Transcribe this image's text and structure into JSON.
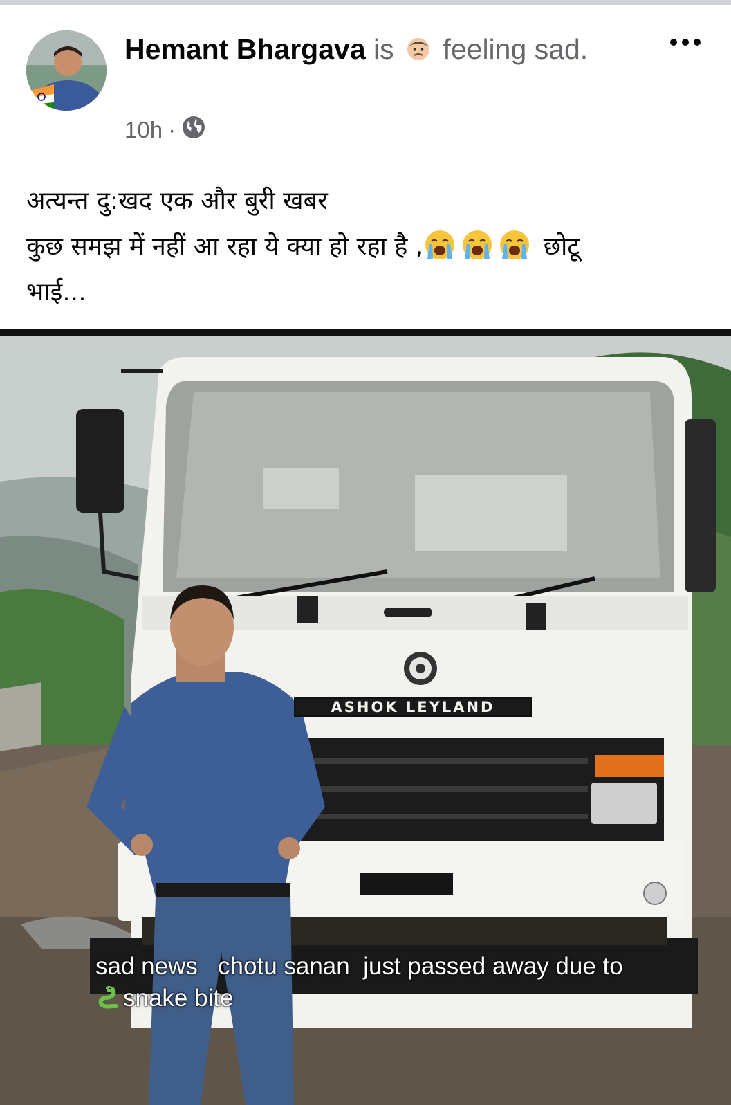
{
  "post": {
    "author": "Hemant Bhargava",
    "is_word": "is",
    "feeling_word": "feeling",
    "feeling": "sad.",
    "time": "10h",
    "separator": "·",
    "privacy_icon": "globe-icon",
    "more_icon": "more-options-icon",
    "text_line1": "अत्यन्त दु:खद एक और बुरी खबर",
    "text_line2_start": "कुछ समझ में नहीं आ रहा ये क्या हो रहा है ,",
    "text_line2_end": " छोटू",
    "text_line3": "भाई..."
  },
  "photo": {
    "caption_line1": "sad news   chotu sanan  just passed away due to",
    "caption_line2": "snake bite",
    "truck_brand": "ASHOK LEYLAND"
  },
  "colors": {
    "text": "#050505",
    "secondary_text": "#65676b",
    "top_border": "#cfd3d8"
  }
}
